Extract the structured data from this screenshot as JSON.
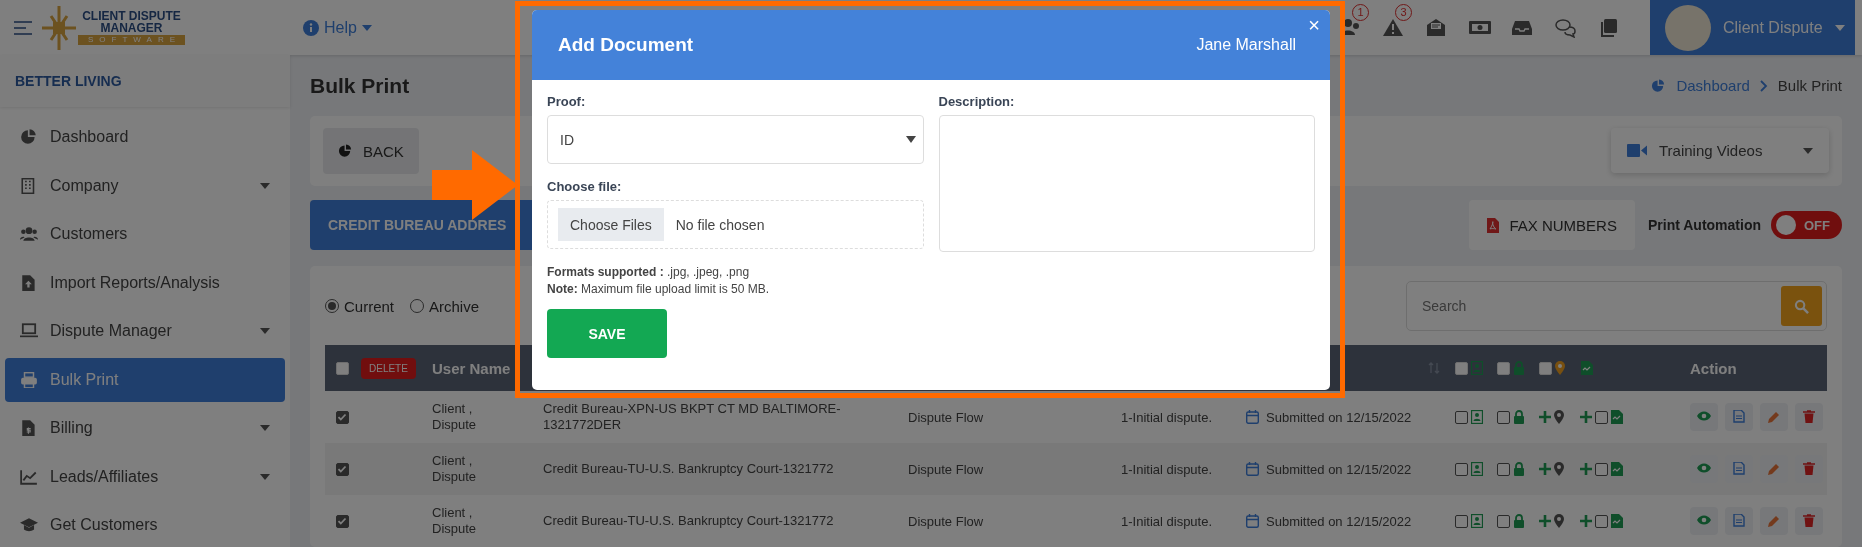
{
  "topbar": {
    "help": "Help",
    "alerts": [
      {
        "badge": "1"
      },
      {
        "badge": "3"
      }
    ],
    "user": "Client Dispute"
  },
  "logo": {
    "title": "CLIENT DISPUTE",
    "subtitle": "MANAGER",
    "tagline": "SOFTWARE"
  },
  "sidebar": {
    "company": "BETTER LIVING",
    "items": [
      {
        "label": "Dashboard",
        "has_submenu": false,
        "selected": false
      },
      {
        "label": "Company",
        "has_submenu": true,
        "selected": false
      },
      {
        "label": "Customers",
        "has_submenu": false,
        "selected": false
      },
      {
        "label": "Import Reports/Analysis",
        "has_submenu": false,
        "selected": false
      },
      {
        "label": "Dispute Manager",
        "has_submenu": true,
        "selected": false
      },
      {
        "label": "Bulk Print",
        "has_submenu": false,
        "selected": true
      },
      {
        "label": "Billing",
        "has_submenu": true,
        "selected": false
      },
      {
        "label": "Leads/Affiliates",
        "has_submenu": true,
        "selected": false
      },
      {
        "label": "Get Customers",
        "has_submenu": false,
        "selected": false
      }
    ]
  },
  "page": {
    "title": "Bulk Print",
    "breadcrumb": [
      {
        "label": "Dashboard",
        "kind": "link"
      },
      {
        "label": "Bulk Print",
        "kind": "current"
      }
    ],
    "back": "BACK",
    "training": "Training Videos",
    "credit_button": "CREDIT BUREAU ADDRES",
    "fax": "FAX NUMBERS",
    "automation": {
      "label": "Print Automation",
      "on": false,
      "state_text": "OFF"
    },
    "filters": [
      {
        "label": "Current",
        "selected": true
      },
      {
        "label": "Archive",
        "selected": false
      }
    ],
    "search": {
      "placeholder": "Search"
    }
  },
  "table": {
    "select_all": {
      "checked": false
    },
    "delete": "DELETE",
    "user_name": "User Name",
    "header_checks": [
      {
        "checked": false
      },
      {
        "checked": false
      },
      {
        "checked": false
      }
    ],
    "action": "Action",
    "rows": [
      {
        "checked": true,
        "user": "Client , Dispute",
        "bureau": "Credit Bureau-XPN-US BKPT CT MD BALTIMORE-1321772DER",
        "flow": "Dispute Flow",
        "stage": "1-Initial dispute.",
        "submitted": "Submitted on 12/15/2022",
        "checks": [
          {
            "checked": false
          },
          {
            "checked": false
          },
          {
            "checked": false
          }
        ]
      },
      {
        "checked": true,
        "user": "Client , Dispute",
        "bureau": "Credit Bureau-TU-U.S. Bankruptcy Court-1321772",
        "flow": "Dispute Flow",
        "stage": "1-Initial dispute.",
        "submitted": "Submitted on 12/15/2022",
        "checks": [
          {
            "checked": false
          },
          {
            "checked": false
          },
          {
            "checked": false
          }
        ]
      },
      {
        "checked": true,
        "user": "Client , Dispute",
        "bureau": "Credit Bureau-TU-U.S. Bankruptcy Court-1321772",
        "flow": "Dispute Flow",
        "stage": "1-Initial dispute.",
        "submitted": "Submitted on 12/15/2022",
        "checks": [
          {
            "checked": false
          },
          {
            "checked": false
          },
          {
            "checked": false
          }
        ]
      }
    ]
  },
  "modal": {
    "title": "Add Document",
    "person": "Jane Marshall",
    "close": "×",
    "proof": {
      "label": "Proof:",
      "value": "ID"
    },
    "file": {
      "label": "Choose file:",
      "button": "Choose Files",
      "status": "No file chosen"
    },
    "formats": "**Formats supported :** .jpg, .jpeg, .png",
    "note": "**Note:** Maximum file upload limit is 50 MB.",
    "description": {
      "label": "Description:"
    },
    "save": "SAVE"
  }
}
